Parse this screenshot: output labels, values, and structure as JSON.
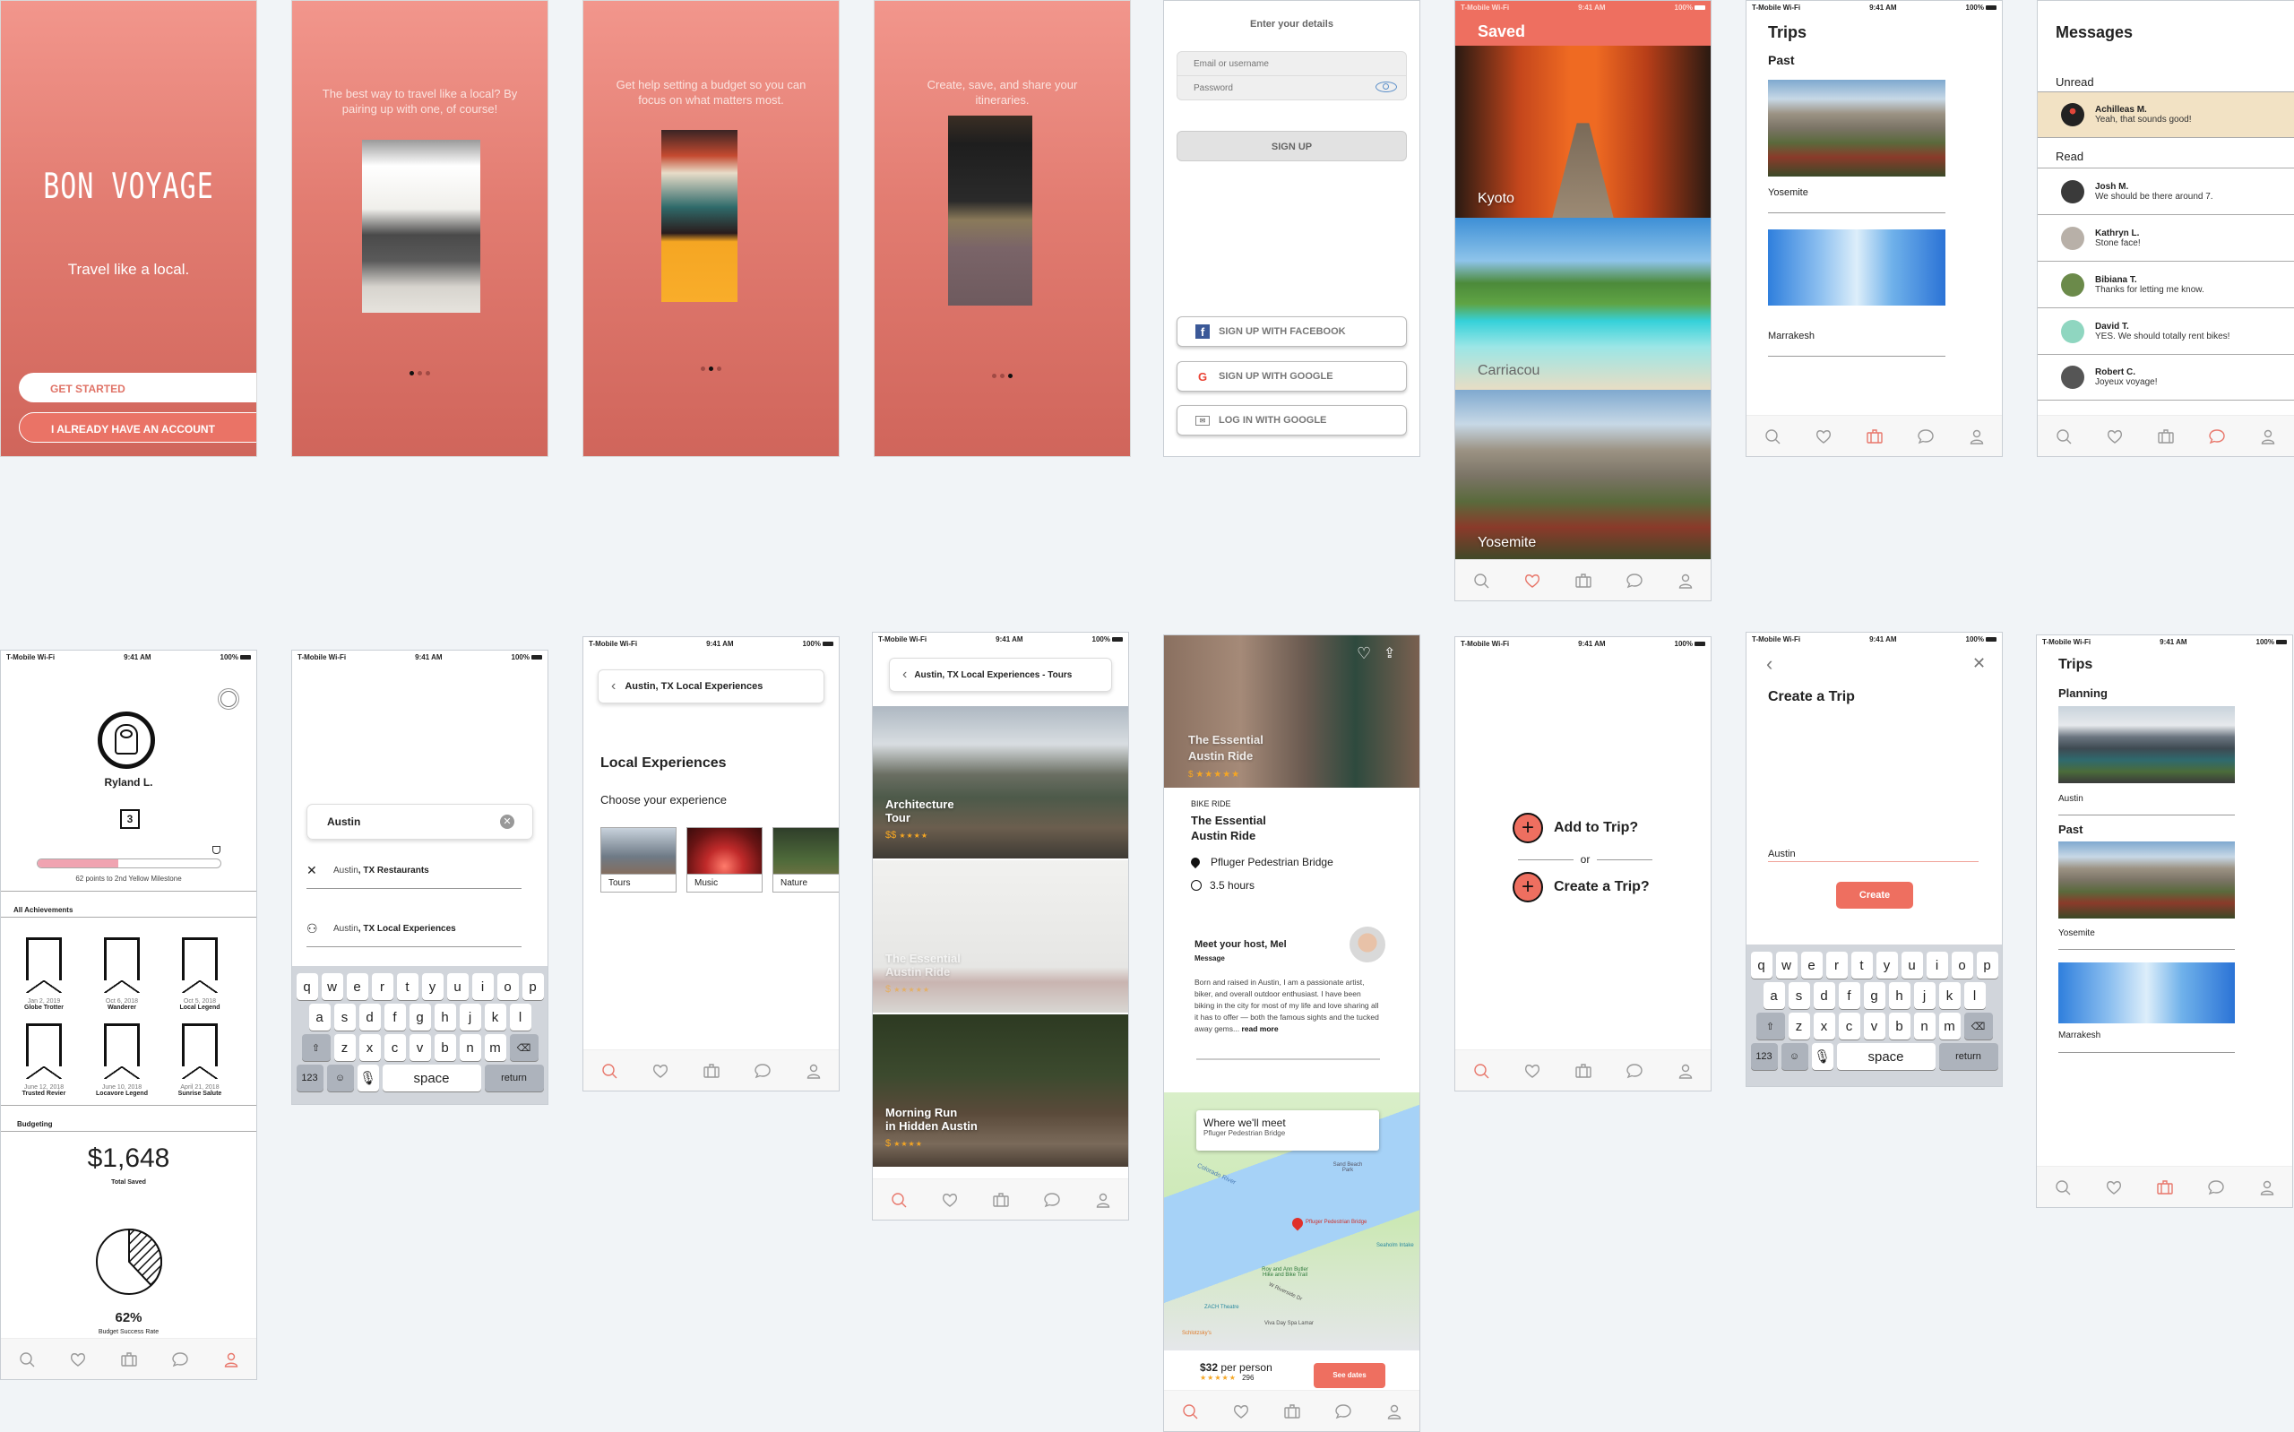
{
  "status_bar": {
    "carrier": "T-Mobile Wi-Fi",
    "time": "9:41 AM",
    "battery": "100%"
  },
  "colors": {
    "accent": "#ee6f60",
    "coral_top": "#f2968c",
    "coral_bottom": "#d0655b",
    "unread_bg": "#f2e2c4",
    "star": "#f5a623",
    "background": "#f1f4f7"
  },
  "tab_bar": [
    {
      "icon": "search-icon",
      "label": "Search"
    },
    {
      "icon": "heart-icon",
      "label": "Saved"
    },
    {
      "icon": "suitcase-icon",
      "label": "Trips"
    },
    {
      "icon": "chat-bubble-icon",
      "label": "Messages"
    },
    {
      "icon": "person-icon",
      "label": "Profile"
    }
  ],
  "welcome": {
    "logo": "BON VOYAGE",
    "tagline": "Travel like a local.",
    "get_started": "GET STARTED",
    "have_account": "I ALREADY HAVE AN ACCOUNT"
  },
  "onboarding": [
    {
      "text": "The best way to travel like a local? By pairing up with one, of course!",
      "active_dot": 0
    },
    {
      "text": "Get help setting a budget so you can focus on what matters most.",
      "active_dot": 1
    },
    {
      "text": "Create, save, and share your itineraries.",
      "active_dot": 2
    }
  ],
  "signup": {
    "title": "Enter your details",
    "email_placeholder": "Email or username",
    "password_placeholder": "Password",
    "sign_up": "SIGN UP",
    "facebook": "SIGN UP WITH FACEBOOK",
    "google": "SIGN UP WITH GOOGLE",
    "login_google": "LOG IN WITH GOOGLE"
  },
  "saved": {
    "title": "Saved",
    "places": [
      "Kyoto",
      "Carriacou",
      "Yosemite"
    ]
  },
  "trips_past": {
    "title": "Trips",
    "section": "Past",
    "items": [
      "Yosemite",
      "Marrakesh"
    ]
  },
  "messages": {
    "title": "Messages",
    "unread_label": "Unread",
    "read_label": "Read",
    "unread": [
      {
        "name": "Achilleas M.",
        "text": "Yeah, that sounds good!"
      }
    ],
    "read": [
      {
        "name": "Josh M.",
        "text": "We should be there around 7."
      },
      {
        "name": "Kathryn L.",
        "text": "Stone face!"
      },
      {
        "name": "Bibiana T.",
        "text": "Thanks for letting me know."
      },
      {
        "name": "David T.",
        "text": "YES. We should totally rent bikes!"
      },
      {
        "name": "Robert C.",
        "text": "Joyeux voyage!"
      }
    ]
  },
  "profile": {
    "name": "Ryland L.",
    "level": "3",
    "progress_fraction": 0.44,
    "milestone_text": "62 points to 2nd Yellow Milestone",
    "achievements_label": "All Achievements",
    "achievements": [
      {
        "date": "Jan 2, 2019",
        "name": "Globe Trotter",
        "icon": "world-map-icon"
      },
      {
        "date": "Oct 6, 2018",
        "name": "Wanderer",
        "icon": "treasure-map-icon"
      },
      {
        "date": "Oct 5, 2018",
        "name": "Local Legend",
        "icon": "friends-icon"
      },
      {
        "date": "June 12, 2018",
        "name": "Trusted Revier",
        "icon": "ribbon-icon"
      },
      {
        "date": "June 10, 2018",
        "name": "Locavore Legend",
        "icon": "taco-icon"
      },
      {
        "date": "April 21, 2018",
        "name": "Sunrise Salute",
        "icon": "sunrise-icon"
      }
    ],
    "budgeting_label": "Budgeting",
    "total_saved": "$1,648",
    "total_saved_label": "Total Saved",
    "success_rate": "62%",
    "success_rate_value": 0.62,
    "success_rate_label": "Budget Success Rate"
  },
  "search": {
    "query": "Austin",
    "results": [
      {
        "icon": "utensils-icon",
        "prefix": "Austin",
        "suffix": ", TX Restaurants"
      },
      {
        "icon": "people-icon",
        "prefix": "Austin",
        "suffix": ", TX Local Experiences"
      }
    ]
  },
  "keyboard": {
    "row1": [
      "q",
      "w",
      "e",
      "r",
      "t",
      "y",
      "u",
      "i",
      "o",
      "p"
    ],
    "row2": [
      "a",
      "s",
      "d",
      "f",
      "g",
      "h",
      "j",
      "k",
      "l"
    ],
    "row3": [
      "z",
      "x",
      "c",
      "v",
      "b",
      "n",
      "m"
    ],
    "numbers": "123",
    "space": "space",
    "return": "return"
  },
  "local_exp": {
    "breadcrumb": "Austin, TX Local Experiences",
    "title": "Local Experiences",
    "subtitle": "Choose your experience",
    "categories": [
      "Tours",
      "Music",
      "Nature"
    ]
  },
  "tours": {
    "breadcrumb": "Austin, TX Local Experiences - Tours",
    "items": [
      {
        "title_line1": "Architecture",
        "title_line2": "Tour",
        "price": "$$",
        "stars": "★★★★"
      },
      {
        "title_line1": "The Essential",
        "title_line2": "Austin Ride",
        "price": "$",
        "stars": "★★★★★"
      },
      {
        "title_line1": "Morning Run",
        "title_line2": "in Hidden Austin",
        "price": "$",
        "stars": "★★★★"
      }
    ]
  },
  "detail": {
    "hero_title_line1": "The Essential",
    "hero_title_line2": "Austin Ride",
    "hero_price": "$",
    "hero_stars": "★★★★★",
    "category": "BIKE RIDE",
    "title_line1": "The Essential",
    "title_line2": "Austin Ride",
    "location": "Pfluger Pedestrian Bridge",
    "duration": "3.5 hours",
    "host_heading": "Meet your host, Mel",
    "message_link": "Message",
    "bio": "Born and raised in Austin, I am a passionate artist, biker, and overall outdoor enthusiast. I have been biking in the city for most of my life and love sharing all it has to offer — both the famous sights and the tucked away gems...",
    "read_more": "read more",
    "map_card_title": "Where we'll meet",
    "map_card_sub": "Pfluger Pedestrian Bridge",
    "map_labels": [
      "Colorado River",
      "Pfluger Pedestrian Bridge",
      "Sand Beach Park",
      "Roy and Ann Butler Hike and Bike Trail",
      "W Riverside Dr",
      "ZACH Theatre",
      "Viva Day Spa Lamar",
      "Schlotzsky's",
      "Seaholm Intake"
    ],
    "price": "$32",
    "price_suffix": "per person",
    "rating_stars": "★★★★★",
    "rating_count": "296",
    "see_dates": "See dates"
  },
  "add_trip": {
    "add": "Add to Trip?",
    "or": "or",
    "create": "Create a Trip?"
  },
  "create_trip": {
    "title": "Create a Trip",
    "input_value": "Austin",
    "create_button": "Create"
  },
  "trips_planning": {
    "title": "Trips",
    "planning_label": "Planning",
    "planning_items": [
      "Austin"
    ],
    "past_label": "Past",
    "past_items": [
      "Yosemite",
      "Marrakesh"
    ]
  }
}
